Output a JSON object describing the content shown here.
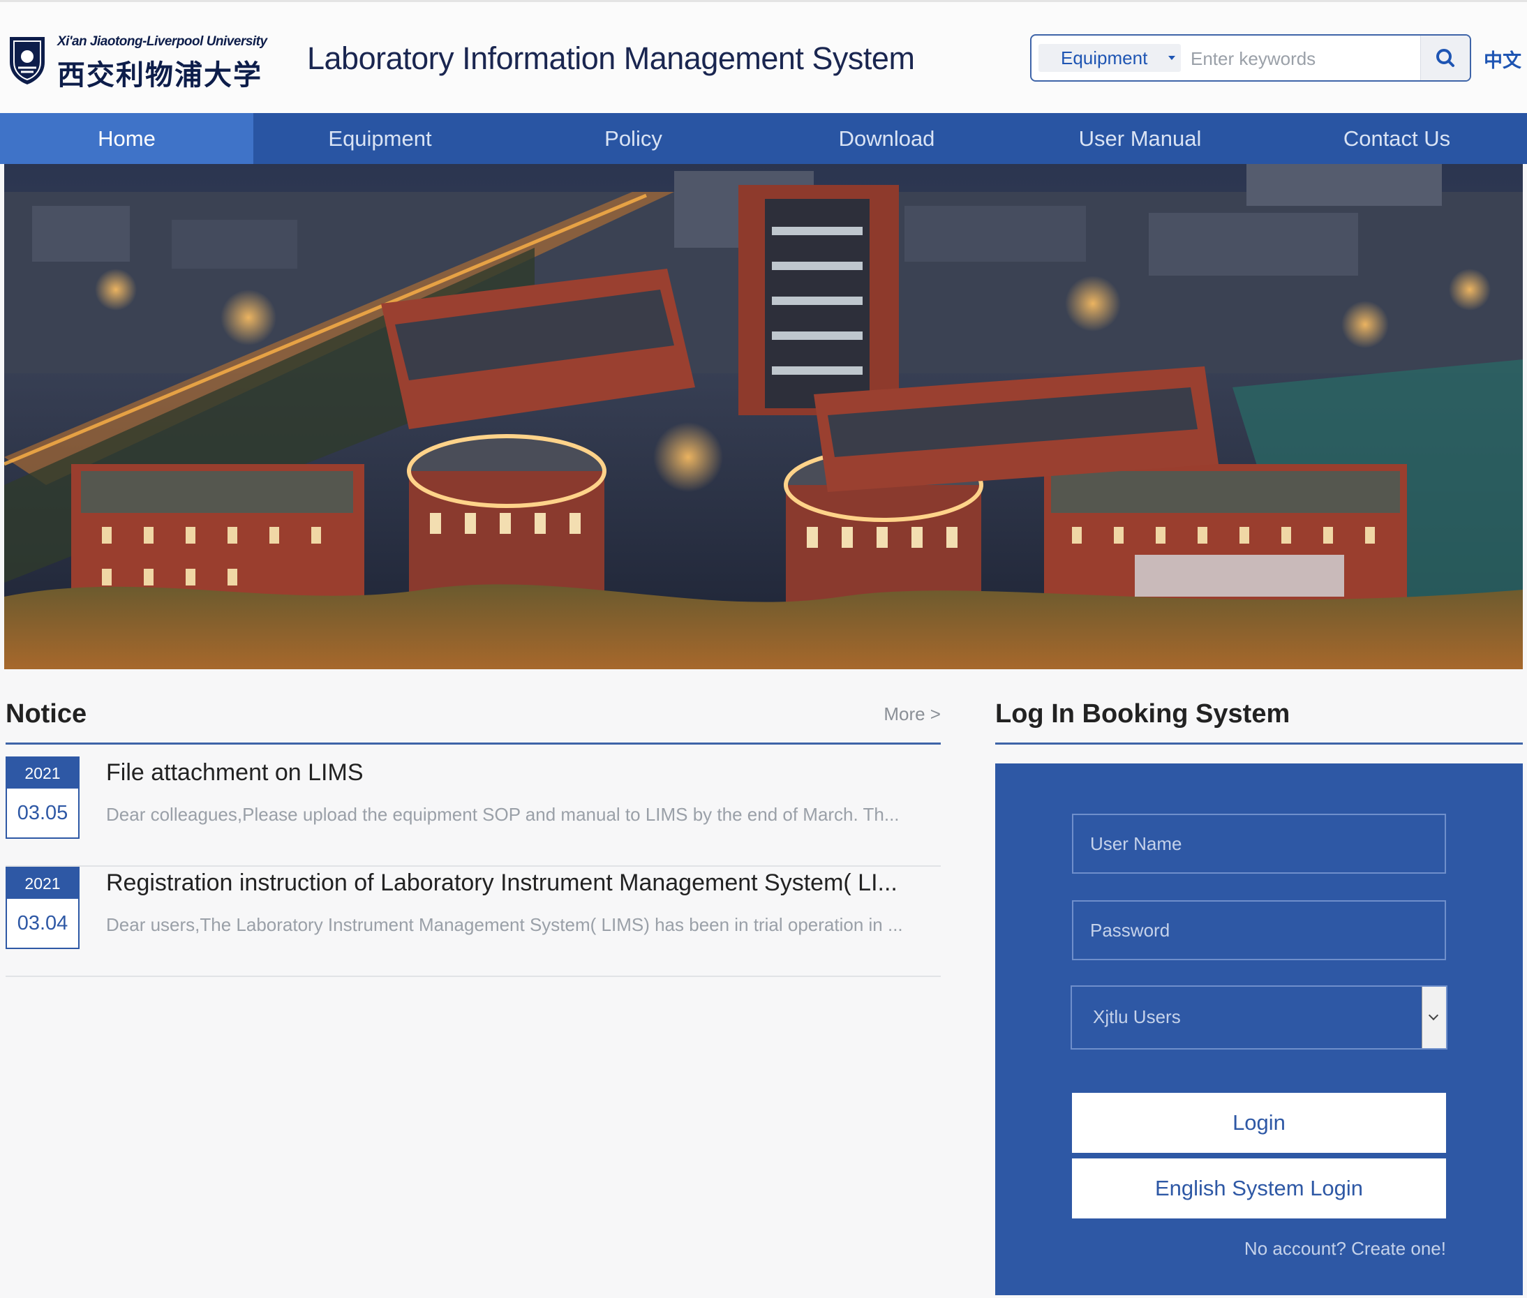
{
  "header": {
    "logo_en": "Xi'an Jiaotong-Liverpool University",
    "logo_cn": "西交利物浦大学",
    "title": "Laboratory Information Management System",
    "search": {
      "category": "Equipment",
      "placeholder": "Enter keywords"
    },
    "language_link": "中文"
  },
  "nav": {
    "items": [
      {
        "label": "Home"
      },
      {
        "label": "Equipment"
      },
      {
        "label": "Policy"
      },
      {
        "label": "Download"
      },
      {
        "label": "User Manual"
      },
      {
        "label": "Contact Us"
      }
    ]
  },
  "notice": {
    "title": "Notice",
    "more": "More >",
    "items": [
      {
        "year": "2021",
        "date": "03.05",
        "title": "File attachment on LIMS",
        "summary": "Dear colleagues,Please upload the equipment SOP and manual to LIMS by the end of March. Th..."
      },
      {
        "year": "2021",
        "date": "03.04",
        "title": "Registration instruction of Laboratory Instrument Management System( LI...",
        "summary": "Dear users,The Laboratory Instrument Management System( LIMS) has been in trial operation in ..."
      }
    ]
  },
  "login": {
    "title": "Log In Booking System",
    "username_placeholder": "User Name",
    "password_placeholder": "Password",
    "user_type": "Xjtlu Users",
    "login_label": "Login",
    "english_login_label": "English System Login",
    "create_account": "No account? Create one!"
  },
  "colors": {
    "nav_bg": "#2955a3",
    "nav_active": "#3f73c8",
    "panel_bg": "#2e58a5",
    "accent": "#1e55b3"
  }
}
